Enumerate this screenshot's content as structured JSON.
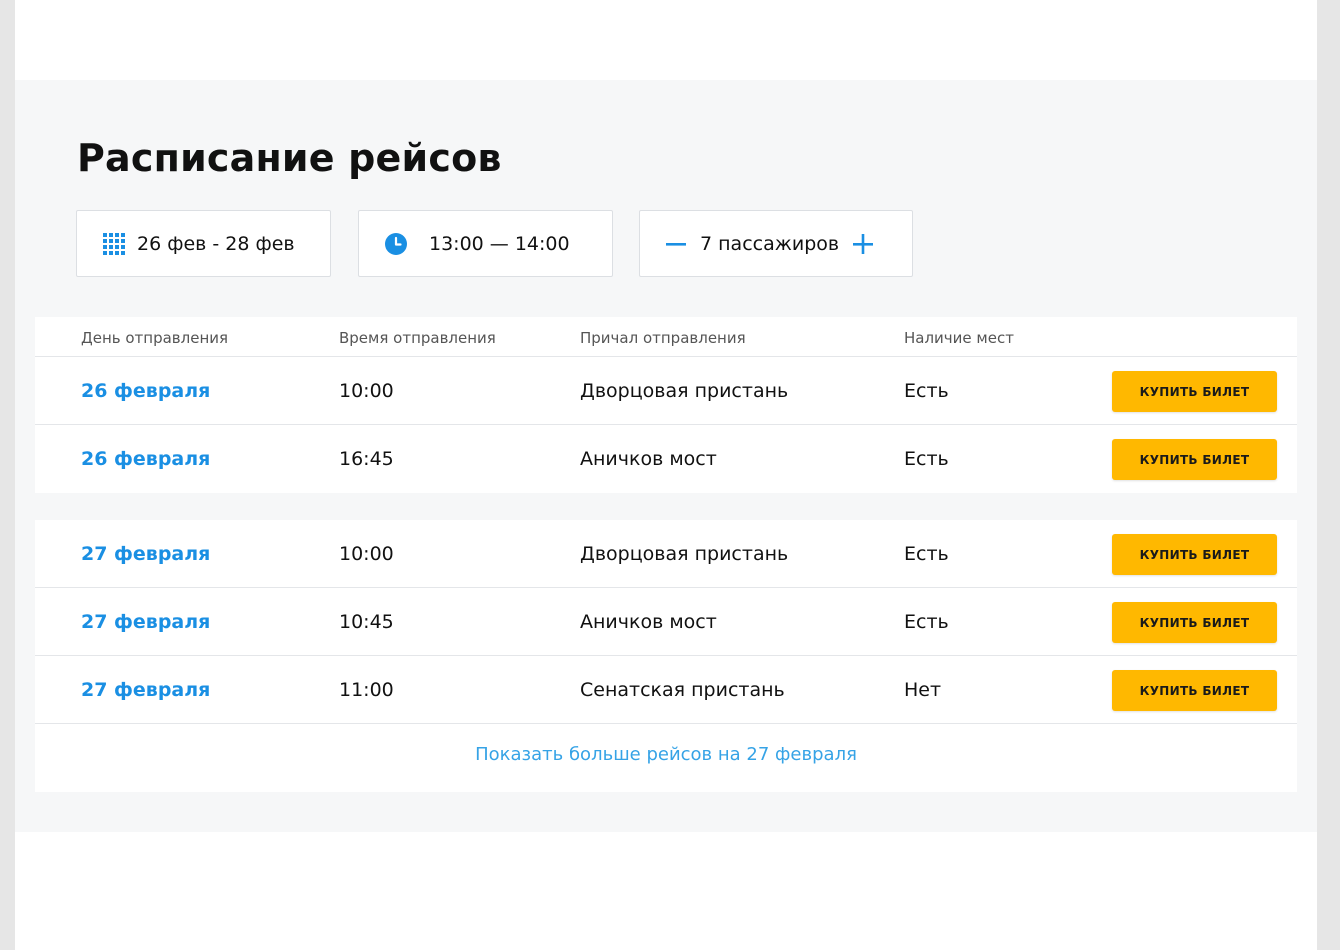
{
  "page": {
    "title": "Расписание рейсов"
  },
  "filters": {
    "date_range": "26 фев - 28 фев",
    "time_range": "13:00 — 14:00",
    "passengers": "7 пассажиров",
    "date_icon": "calendar-grid-icon",
    "time_icon": "clock-icon",
    "minus_icon": "minus-icon",
    "plus_icon": "plus-icon"
  },
  "table": {
    "headers": [
      "День отправления",
      "Время отправления",
      "Причал отправления",
      "Наличие мест"
    ],
    "group1": [
      {
        "date": "26 февраля",
        "time": "10:00",
        "pier": "Дворцовая пристань",
        "availability": "Есть",
        "button": "Купить билет"
      },
      {
        "date": "26 февраля",
        "time": "16:45",
        "pier": "Аничков мост",
        "availability": "Есть",
        "button": "Купить билет"
      }
    ],
    "group2": [
      {
        "date": "27 февраля",
        "time": "10:00",
        "pier": "Дворцовая пристань",
        "availability": "Есть",
        "button": "Купить билет"
      },
      {
        "date": "27 февраля",
        "time": "10:45",
        "pier": "Аничков мост",
        "availability": "Есть",
        "button": "Купить билет"
      },
      {
        "date": "27 февраля",
        "time": "11:00",
        "pier": "Сенатская пристань",
        "availability": "Нет",
        "button": "Купить билет"
      }
    ],
    "show_more": "Показать больше рейсов на 27 февраля"
  },
  "colors": {
    "accent": "#1a8fe3",
    "button": "#ffb800",
    "link": "#36a3e6"
  }
}
